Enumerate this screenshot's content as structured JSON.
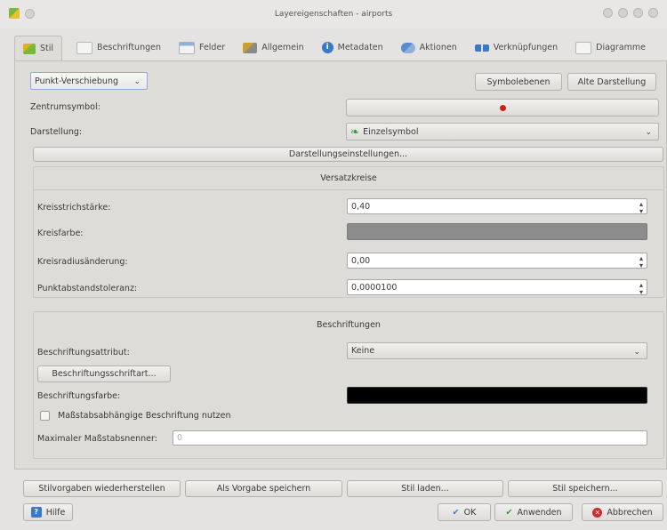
{
  "window": {
    "title": "Layereigenschaften - airports"
  },
  "tabs": [
    {
      "label": "Stil",
      "icon": "brush-icon",
      "active": true
    },
    {
      "label": "Beschriftungen",
      "icon": "labels-icon",
      "active": false
    },
    {
      "label": "Felder",
      "icon": "table-icon",
      "active": false
    },
    {
      "label": "Allgemein",
      "icon": "tools-icon",
      "active": false
    },
    {
      "label": "Metadaten",
      "icon": "info-icon",
      "active": false
    },
    {
      "label": "Aktionen",
      "icon": "actions-icon",
      "active": false
    },
    {
      "label": "Verknüpfungen",
      "icon": "joins-icon",
      "active": false
    },
    {
      "label": "Diagramme",
      "icon": "diagram-icon",
      "active": false
    }
  ],
  "style": {
    "renderer_type": "Punkt-Verschiebung",
    "symbol_levels_button": "Symbolebenen",
    "old_style_button": "Alte Darstellung",
    "center_symbol_label": "Zentrumsymbol:",
    "center_symbol_color": "#cc1f1f",
    "renderer_label": "Darstellung:",
    "renderer_value": "Einzelsymbol",
    "renderer_settings_button": "Darstellungseinstellungen..."
  },
  "circles": {
    "heading": "Versatzkreise",
    "stroke_width_label": "Kreisstrichstärke:",
    "stroke_width_value": "0,40",
    "color_label": "Kreisfarbe:",
    "color": "#8c8c8c",
    "radius_label": "Kreisradiusänderung:",
    "radius_value": "0,00",
    "tolerance_label": "Punktabstandstoleranz:",
    "tolerance_value": "0,0000100"
  },
  "labels": {
    "heading": "Beschriftungen",
    "attribute_label": "Beschriftungsattribut:",
    "attribute_value": "Keine",
    "font_button": "Beschriftungsschriftart...",
    "color_label": "Beschriftungsfarbe:",
    "color": "#000000",
    "scale_checkbox_label": "Maßstabsabhängige Beschriftung nutzen",
    "max_scale_label": "Maximaler Maßstabsnenner:",
    "max_scale_value": "0"
  },
  "bottom": {
    "restore_default": "Stilvorgaben wiederherstellen",
    "save_default": "Als Vorgabe speichern",
    "load_style": "Stil laden...",
    "save_style": "Stil speichern...",
    "help": "Hilfe",
    "ok": "OK",
    "apply": "Anwenden",
    "cancel": "Abbrechen"
  }
}
